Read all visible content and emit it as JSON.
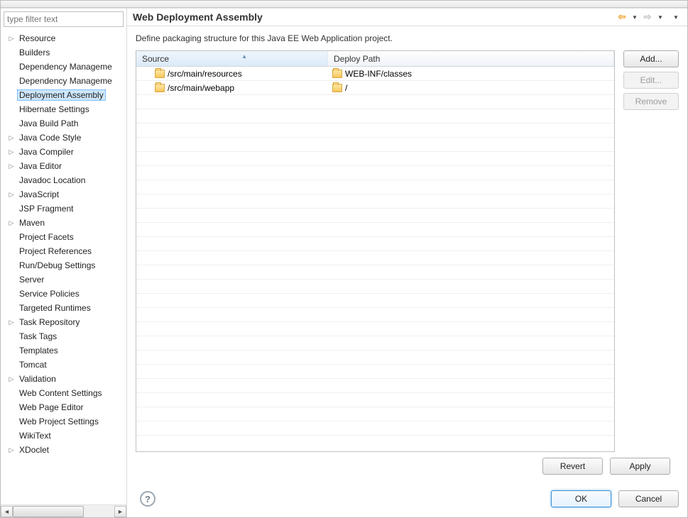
{
  "filter_placeholder": "type filter text",
  "sidebar": {
    "items": [
      {
        "label": "Resource",
        "expandable": true
      },
      {
        "label": "Builders",
        "expandable": false
      },
      {
        "label": "Dependency Manageme",
        "expandable": false
      },
      {
        "label": "Dependency Manageme",
        "expandable": false
      },
      {
        "label": "Deployment Assembly",
        "expandable": false,
        "selected": true
      },
      {
        "label": "Hibernate Settings",
        "expandable": false
      },
      {
        "label": "Java Build Path",
        "expandable": false
      },
      {
        "label": "Java Code Style",
        "expandable": true
      },
      {
        "label": "Java Compiler",
        "expandable": true
      },
      {
        "label": "Java Editor",
        "expandable": true
      },
      {
        "label": "Javadoc Location",
        "expandable": false
      },
      {
        "label": "JavaScript",
        "expandable": true
      },
      {
        "label": "JSP Fragment",
        "expandable": false
      },
      {
        "label": "Maven",
        "expandable": true
      },
      {
        "label": "Project Facets",
        "expandable": false
      },
      {
        "label": "Project References",
        "expandable": false
      },
      {
        "label": "Run/Debug Settings",
        "expandable": false
      },
      {
        "label": "Server",
        "expandable": false
      },
      {
        "label": "Service Policies",
        "expandable": false
      },
      {
        "label": "Targeted Runtimes",
        "expandable": false
      },
      {
        "label": "Task Repository",
        "expandable": true
      },
      {
        "label": "Task Tags",
        "expandable": false
      },
      {
        "label": "Templates",
        "expandable": false
      },
      {
        "label": "Tomcat",
        "expandable": false
      },
      {
        "label": "Validation",
        "expandable": true
      },
      {
        "label": "Web Content Settings",
        "expandable": false
      },
      {
        "label": "Web Page Editor",
        "expandable": false
      },
      {
        "label": "Web Project Settings",
        "expandable": false
      },
      {
        "label": "WikiText",
        "expandable": false
      },
      {
        "label": "XDoclet",
        "expandable": true
      }
    ]
  },
  "page": {
    "title": "Web Deployment Assembly",
    "description": "Define packaging structure for this Java EE Web Application project."
  },
  "table": {
    "col_source": "Source",
    "col_deploy": "Deploy Path",
    "rows": [
      {
        "source": "/src/main/resources",
        "deploy": "WEB-INF/classes"
      },
      {
        "source": "/src/main/webapp",
        "deploy": "/"
      }
    ],
    "empty_rows": 24
  },
  "buttons": {
    "add": "Add...",
    "edit": "Edit...",
    "remove": "Remove",
    "revert": "Revert",
    "apply": "Apply",
    "ok": "OK",
    "cancel": "Cancel"
  }
}
